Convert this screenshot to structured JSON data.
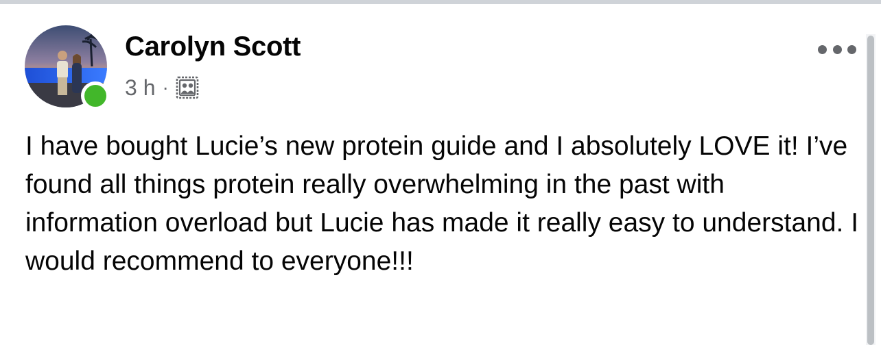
{
  "post": {
    "author": "Carolyn Scott",
    "time": "3 h",
    "separator": "·",
    "audience_icon": "friends-group-icon",
    "online_status_color": "#42b72a",
    "more_icon": "more-options-icon",
    "text": "I have bought Lucie’s new protein guide and I absolutely LOVE it! I’ve found all things protein really overwhelming in the past with information overload but Lucie has made it really easy to understand. I would recommend to everyone!!!"
  },
  "colors": {
    "name": "#050505",
    "meta": "#65676b",
    "top_strip": "#cfd3d8"
  }
}
